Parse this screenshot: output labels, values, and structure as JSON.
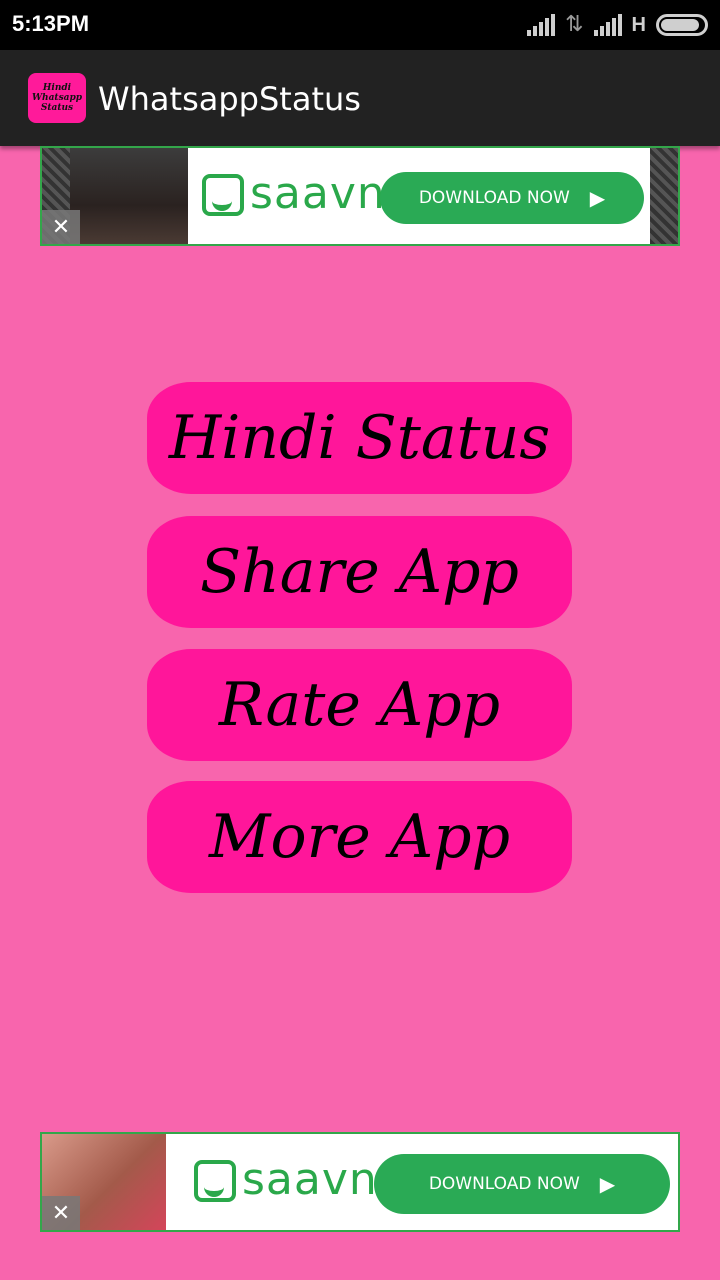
{
  "status": {
    "time": "5:13PM",
    "network": "H"
  },
  "appbar": {
    "title": "WhatsappStatus",
    "icon_text": [
      "Hindi",
      "Whatsapp",
      "Status"
    ]
  },
  "ads": {
    "top": {
      "brand": "saavn",
      "cta": "DOWNLOAD NOW",
      "close": "✕"
    },
    "bottom": {
      "brand": "saavn",
      "cta": "DOWNLOAD NOW",
      "close": "✕"
    }
  },
  "menu": [
    "Hindi Status",
    "Share App",
    "Rate App",
    "More App"
  ],
  "colors": {
    "background": "#f865ad",
    "button": "#ff169a",
    "appbar": "#222222",
    "accent": "#2aa84a"
  }
}
